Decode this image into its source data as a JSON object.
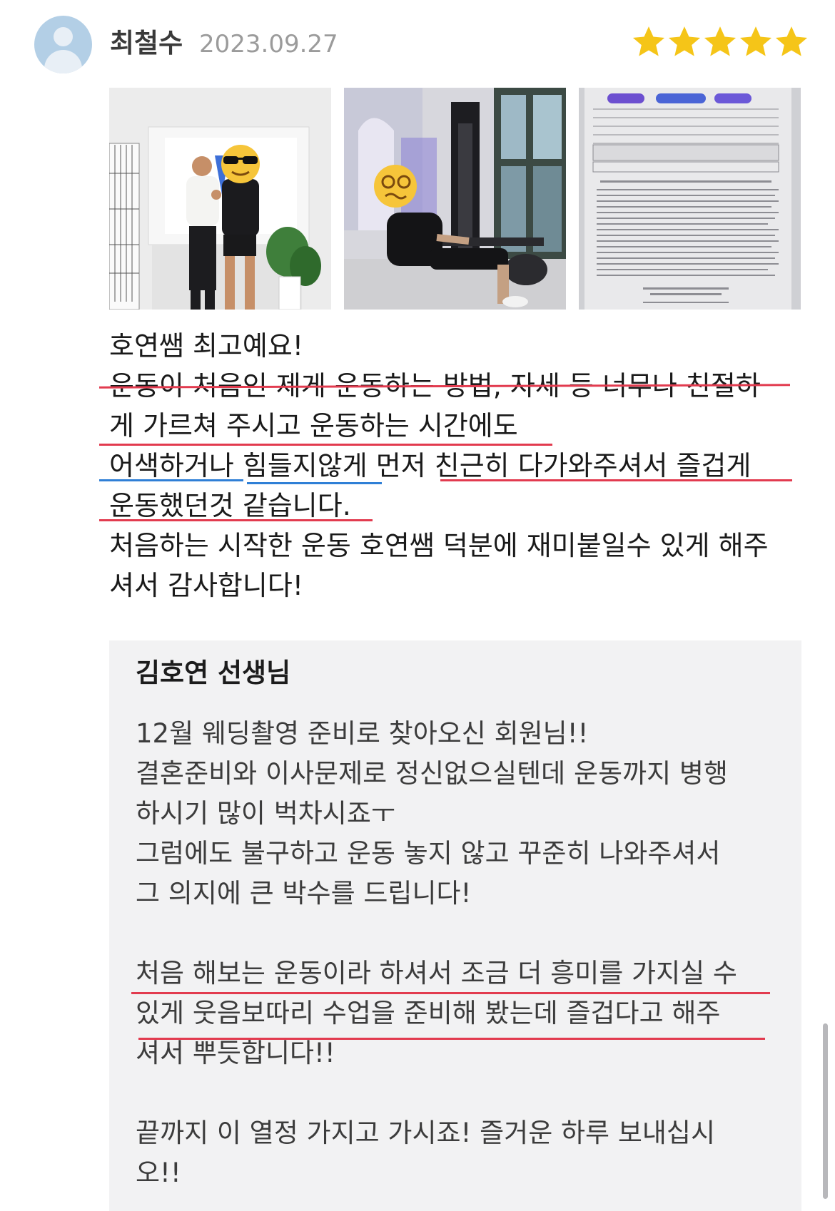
{
  "review": {
    "reviewer_name": "최철수",
    "date": "2023.09.27",
    "rating": 5,
    "rating_max": 5,
    "star_color": "#f5c518",
    "avatar_icon": "default-user-icon",
    "photos": [
      {
        "name": "review-photo-trainer-member",
        "icon": "sunglasses-emoji-icon"
      },
      {
        "name": "review-photo-gym-rowing",
        "icon": "dizzy-face-emoji-icon"
      },
      {
        "name": "review-photo-document",
        "icon": "document-icon"
      }
    ],
    "text_lines": [
      "호연쌤 최고예요!",
      "운동이 처음인 제게 운동하는 방법, 자세 등 너무나 친절하",
      "게 가르쳐 주시고 운동하는 시간에도",
      "어색하거나 힘들지않게 먼저 친근히 다가와주셔서 즐겁게",
      "운동했던것 같습니다.",
      "처음하는 시작한 운동 호연쌤 덕분에 재미붙일수 있게 해주",
      "셔서 감사합니다!"
    ]
  },
  "reply": {
    "author": "김호연 선생님",
    "paragraphs": [
      [
        "12월 웨딩촬영 준비로 찾아오신 회원님!!",
        "결혼준비와 이사문제로 정신없으실텐데 운동까지 병행",
        "하시기 많이 벅차시죠ㅜ",
        "그럼에도 불구하고 운동 놓지 않고 꾸준히 나와주셔서",
        "그 의지에 큰 박수를 드립니다!"
      ],
      [
        "처음 해보는 운동이라 하셔서 조금 더 흥미를 가지실 수",
        "있게 웃음보따리 수업을 준비해 봤는데 즐겁다고 해주",
        "셔서 뿌듯합니다!!"
      ],
      [
        "끝까지 이 열정 가지고 가시죠! 즐거운 하루 보내십시",
        "오!!"
      ]
    ]
  },
  "colors": {
    "underline_red": "#e23b4f",
    "underline_blue": "#2f7fd6",
    "reply_background": "#f2f2f3"
  }
}
